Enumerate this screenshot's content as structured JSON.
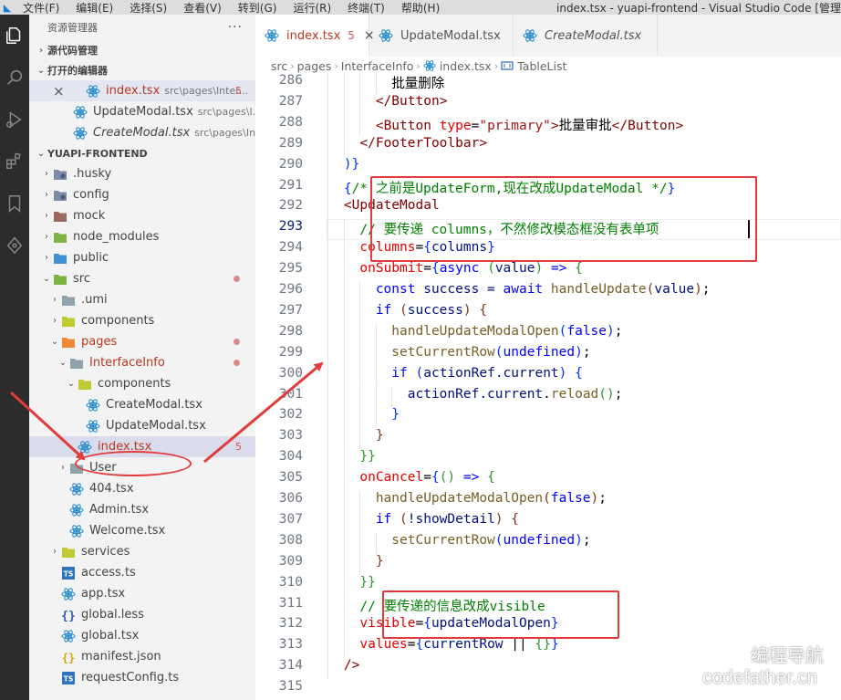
{
  "menu": [
    "文件(F)",
    "编辑(E)",
    "选择(S)",
    "查看(V)",
    "转到(G)",
    "运行(R)",
    "终端(T)",
    "帮助(H)"
  ],
  "window_title": "index.tsx - yuapi-frontend - Visual Studio Code [管理员]",
  "sidebar": {
    "title": "资源管理器",
    "more": "···",
    "source_control": "源代码管理",
    "open_editors_title": "打开的编辑器",
    "open_editors": [
      {
        "name": "index.tsx",
        "path": "src\\pages\\Inter...",
        "badge": "5"
      },
      {
        "name": "UpdateModal.tsx",
        "path": "src\\pages\\I..."
      },
      {
        "name": "CreateModal.tsx",
        "path": "src\\pages\\Int..."
      }
    ],
    "project_title": "YUAPI-FRONTEND",
    "tree": [
      {
        "label": ".husky",
        "level": 1,
        "chev": "›",
        "icon": "folder-gear-icon"
      },
      {
        "label": "config",
        "level": 1,
        "chev": "›",
        "icon": "folder-gear-icon"
      },
      {
        "label": "mock",
        "level": 1,
        "chev": "›",
        "icon": "folder-mock-icon"
      },
      {
        "label": "node_modules",
        "level": 1,
        "chev": "›",
        "icon": "folder-green-icon"
      },
      {
        "label": "public",
        "level": 1,
        "chev": "›",
        "icon": "folder-blue-icon"
      },
      {
        "label": "src",
        "level": 1,
        "chev": "⌄",
        "icon": "folder-green-icon",
        "dot": true
      },
      {
        "label": ".umi",
        "level": 2,
        "chev": "›",
        "icon": "folder-gray-icon"
      },
      {
        "label": "components",
        "level": 2,
        "chev": "›",
        "icon": "folder-yellow-icon"
      },
      {
        "label": "pages",
        "level": 2,
        "chev": "⌄",
        "icon": "folder-orange-icon",
        "dot": true,
        "red": true
      },
      {
        "label": "InterfaceInfo",
        "level": 3,
        "chev": "⌄",
        "icon": "folder-gray-icon",
        "dot": true,
        "red": true
      },
      {
        "label": "components",
        "level": 4,
        "chev": "⌄",
        "icon": "folder-yellow-icon"
      },
      {
        "label": "CreateModal.tsx",
        "level": 5,
        "chev": "",
        "icon": "react-icon"
      },
      {
        "label": "UpdateModal.tsx",
        "level": 5,
        "chev": "",
        "icon": "react-icon"
      },
      {
        "label": "index.tsx",
        "level": 4,
        "chev": "",
        "icon": "react-icon",
        "badge": "5",
        "red": true,
        "active": true
      },
      {
        "label": "User",
        "level": 3,
        "chev": "›",
        "icon": "folder-gray-icon"
      },
      {
        "label": "404.tsx",
        "level": 3,
        "chev": "",
        "icon": "react-icon"
      },
      {
        "label": "Admin.tsx",
        "level": 3,
        "chev": "",
        "icon": "react-icon"
      },
      {
        "label": "Welcome.tsx",
        "level": 3,
        "chev": "",
        "icon": "react-icon"
      },
      {
        "label": "services",
        "level": 2,
        "chev": "›",
        "icon": "folder-yellow-icon"
      },
      {
        "label": "access.ts",
        "level": 2,
        "chev": "",
        "icon": "ts-icon"
      },
      {
        "label": "app.tsx",
        "level": 2,
        "chev": "",
        "icon": "react-icon"
      },
      {
        "label": "global.less",
        "level": 2,
        "chev": "",
        "icon": "braces-icon"
      },
      {
        "label": "global.tsx",
        "level": 2,
        "chev": "",
        "icon": "react-icon"
      },
      {
        "label": "manifest.json",
        "level": 2,
        "chev": "",
        "icon": "json-icon"
      },
      {
        "label": "requestConfig.ts",
        "level": 2,
        "chev": "",
        "icon": "ts-icon"
      }
    ]
  },
  "tabs": [
    {
      "label": "index.tsx",
      "badge": "5",
      "close": "×",
      "active": true
    },
    {
      "label": "UpdateModal.tsx"
    },
    {
      "label": "CreateModal.tsx",
      "italic": true
    }
  ],
  "breadcrumb": [
    "src",
    "pages",
    "InterfaceInfo",
    "index.tsx",
    "TableList"
  ],
  "editor": {
    "first_line": 286,
    "current_line": 293,
    "lines": [
      {
        "indent": 10,
        "tokens": [
          [
            "批量删除",
            "pun"
          ]
        ]
      },
      {
        "indent": 8,
        "tokens": [
          [
            "</",
            "tag"
          ],
          [
            "Button",
            "tag"
          ],
          [
            ">",
            "tag"
          ]
        ]
      },
      {
        "indent": 8,
        "tokens": [
          [
            "<",
            "tag"
          ],
          [
            "Button",
            "tag"
          ],
          [
            " ",
            "pun"
          ],
          [
            "type",
            "attr"
          ],
          [
            "=",
            "pun"
          ],
          [
            "\"primary\"",
            "str"
          ],
          [
            ">",
            "tag"
          ],
          [
            "批量审批",
            "pun"
          ],
          [
            "</",
            "tag"
          ],
          [
            "Button",
            "tag"
          ],
          [
            ">",
            "tag"
          ]
        ]
      },
      {
        "indent": 6,
        "tokens": [
          [
            "</",
            "tag"
          ],
          [
            "FooterToolbar",
            "tag"
          ],
          [
            ">",
            "tag"
          ]
        ]
      },
      {
        "indent": 4,
        "tokens": [
          [
            ")}",
            "br1"
          ]
        ]
      },
      {
        "indent": 4,
        "tokens": [
          [
            "{",
            "br1"
          ],
          [
            "/* 之前是UpdateForm,现在改成UpdateModal */",
            "com"
          ],
          [
            "}",
            "br1"
          ]
        ]
      },
      {
        "indent": 4,
        "tokens": [
          [
            "<",
            "tag"
          ],
          [
            "UpdateModal",
            "tag"
          ]
        ]
      },
      {
        "indent": 6,
        "tokens": [
          [
            "// 要传递 columns，不然修改模态框没有表单项",
            "com"
          ]
        ]
      },
      {
        "indent": 6,
        "tokens": [
          [
            "columns",
            "attr"
          ],
          [
            "=",
            "pun"
          ],
          [
            "{",
            "br1"
          ],
          [
            "columns",
            "var"
          ],
          [
            "}",
            "br1"
          ]
        ]
      },
      {
        "indent": 6,
        "tokens": [
          [
            "onSubmit",
            "attr"
          ],
          [
            "=",
            "pun"
          ],
          [
            "{",
            "br1"
          ],
          [
            "async",
            "kw"
          ],
          [
            " ",
            "pun"
          ],
          [
            "(",
            "br2"
          ],
          [
            "value",
            "var"
          ],
          [
            ")",
            "br2"
          ],
          [
            " ",
            "pun"
          ],
          [
            "=>",
            "kw"
          ],
          [
            " ",
            "pun"
          ],
          [
            "{",
            "br2"
          ]
        ]
      },
      {
        "indent": 8,
        "tokens": [
          [
            "const",
            "kw"
          ],
          [
            " success = ",
            "var"
          ],
          [
            "await",
            "kw"
          ],
          [
            " ",
            "pun"
          ],
          [
            "handleUpdate",
            "fn"
          ],
          [
            "(",
            "br3"
          ],
          [
            "value",
            "var"
          ],
          [
            ")",
            "br3"
          ],
          [
            ";",
            "pun"
          ]
        ]
      },
      {
        "indent": 8,
        "tokens": [
          [
            "if",
            "kw"
          ],
          [
            " ",
            "pun"
          ],
          [
            "(",
            "br3"
          ],
          [
            "success",
            "var"
          ],
          [
            ")",
            "br3"
          ],
          [
            " ",
            "pun"
          ],
          [
            "{",
            "br3"
          ]
        ]
      },
      {
        "indent": 10,
        "tokens": [
          [
            "handleUpdateModalOpen",
            "fn"
          ],
          [
            "(",
            "br1"
          ],
          [
            "false",
            "kw"
          ],
          [
            ")",
            "br1"
          ],
          [
            ";",
            "pun"
          ]
        ]
      },
      {
        "indent": 10,
        "tokens": [
          [
            "setCurrentRow",
            "fn"
          ],
          [
            "(",
            "br1"
          ],
          [
            "undefined",
            "kw"
          ],
          [
            ")",
            "br1"
          ],
          [
            ";",
            "pun"
          ]
        ]
      },
      {
        "indent": 10,
        "tokens": [
          [
            "if",
            "kw"
          ],
          [
            " ",
            "pun"
          ],
          [
            "(",
            "br1"
          ],
          [
            "actionRef",
            "var"
          ],
          [
            ".current",
            "var"
          ],
          [
            ")",
            "br1"
          ],
          [
            " ",
            "pun"
          ],
          [
            "{",
            "br1"
          ]
        ]
      },
      {
        "indent": 12,
        "tokens": [
          [
            "actionRef",
            "var"
          ],
          [
            ".current",
            "var"
          ],
          [
            ".",
            "pun"
          ],
          [
            "reload",
            "fn"
          ],
          [
            "(",
            "br2"
          ],
          [
            ")",
            "br2"
          ],
          [
            ";",
            "pun"
          ]
        ]
      },
      {
        "indent": 10,
        "tokens": [
          [
            "}",
            "br1"
          ]
        ]
      },
      {
        "indent": 8,
        "tokens": [
          [
            "}",
            "br3"
          ]
        ]
      },
      {
        "indent": 6,
        "tokens": [
          [
            "}}",
            "br2"
          ]
        ]
      },
      {
        "indent": 6,
        "tokens": [
          [
            "onCancel",
            "attr"
          ],
          [
            "=",
            "pun"
          ],
          [
            "{",
            "br1"
          ],
          [
            "()",
            "br2"
          ],
          [
            " ",
            "pun"
          ],
          [
            "=>",
            "kw"
          ],
          [
            " ",
            "pun"
          ],
          [
            "{",
            "br2"
          ]
        ]
      },
      {
        "indent": 8,
        "tokens": [
          [
            "handleUpdateModalOpen",
            "fn"
          ],
          [
            "(",
            "br3"
          ],
          [
            "false",
            "kw"
          ],
          [
            ")",
            "br3"
          ],
          [
            ";",
            "pun"
          ]
        ]
      },
      {
        "indent": 8,
        "tokens": [
          [
            "if",
            "kw"
          ],
          [
            " ",
            "pun"
          ],
          [
            "(",
            "br3"
          ],
          [
            "!showDetail",
            "var"
          ],
          [
            ")",
            "br3"
          ],
          [
            " ",
            "pun"
          ],
          [
            "{",
            "br3"
          ]
        ]
      },
      {
        "indent": 10,
        "tokens": [
          [
            "setCurrentRow",
            "fn"
          ],
          [
            "(",
            "br1"
          ],
          [
            "undefined",
            "kw"
          ],
          [
            ")",
            "br1"
          ],
          [
            ";",
            "pun"
          ]
        ]
      },
      {
        "indent": 8,
        "tokens": [
          [
            "}",
            "br3"
          ]
        ]
      },
      {
        "indent": 6,
        "tokens": [
          [
            "}}",
            "br2"
          ]
        ]
      },
      {
        "indent": 6,
        "tokens": [
          [
            "// 要传递的信息改成visible",
            "com"
          ]
        ]
      },
      {
        "indent": 6,
        "tokens": [
          [
            "visible",
            "attr"
          ],
          [
            "=",
            "pun"
          ],
          [
            "{",
            "br1"
          ],
          [
            "updateModalOpen",
            "var"
          ],
          [
            "}",
            "br1"
          ]
        ]
      },
      {
        "indent": 6,
        "tokens": [
          [
            "values",
            "attr"
          ],
          [
            "=",
            "pun"
          ],
          [
            "{",
            "br1"
          ],
          [
            "currentRow",
            "var"
          ],
          [
            " || ",
            "pun"
          ],
          [
            "{}",
            "br2"
          ],
          [
            "}",
            "br1"
          ]
        ]
      },
      {
        "indent": 4,
        "tokens": [
          [
            "/>",
            "tag"
          ]
        ]
      },
      {
        "indent": 0,
        "tokens": []
      }
    ]
  },
  "watermark": {
    "line1": "编程导航",
    "line2": "codefather.cn"
  },
  "colors": {
    "annotation": "#e23b3b",
    "accent": "#1f7ad6",
    "error": "#b7381f"
  }
}
